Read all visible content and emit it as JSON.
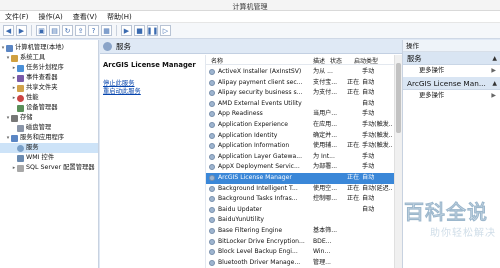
{
  "window": {
    "title": "计算机管理"
  },
  "menu": [
    "文件(F)",
    "操作(A)",
    "查看(V)",
    "帮助(H)"
  ],
  "toolbar_icons": [
    "back-icon",
    "forward-icon",
    "folder-icon",
    "view-icon",
    "refresh-icon",
    "export-icon",
    "help-icon",
    "console-icon",
    "play-icon",
    "stop-icon",
    "pause-icon",
    "restart-icon"
  ],
  "tree": {
    "root": "计算机管理(本地)",
    "system_tools": "系统工具",
    "task_scheduler": "任务计划程序",
    "event_viewer": "事件查看器",
    "shared_folders": "共享文件夹",
    "performance": "性能",
    "device_manager": "设备管理器",
    "storage": "存储",
    "disk_management": "磁盘管理",
    "services_apps": "服务和应用程序",
    "services": "服务",
    "wmi": "WMI 控件",
    "sql": "SQL Server 配置管理器"
  },
  "main": {
    "title": "服务",
    "selected_service": "ArcGIS License Manager",
    "stop_link": "停止此服务",
    "restart_link": "重启动此服务",
    "columns": {
      "name": "名称",
      "desc": "描述",
      "status": "状态",
      "startup": "启动类型"
    },
    "rows": [
      {
        "name": "ActiveX Installer (AxInstSV)",
        "desc": "为从 ...",
        "status": "",
        "startup": "手动"
      },
      {
        "name": "Alipay payment client sec...",
        "desc": "支付宝...",
        "status": "正在...",
        "startup": "自动"
      },
      {
        "name": "Alipay security business s...",
        "desc": "为支付...",
        "status": "正在...",
        "startup": "自动"
      },
      {
        "name": "AMD External Events Utility",
        "desc": "",
        "status": "",
        "startup": "自动"
      },
      {
        "name": "App Readiness",
        "desc": "当用户...",
        "status": "",
        "startup": "手动"
      },
      {
        "name": "Application Experience",
        "desc": "在应用...",
        "status": "",
        "startup": "手动(触发..."
      },
      {
        "name": "Application Identity",
        "desc": "确定并...",
        "status": "",
        "startup": "手动(触发..."
      },
      {
        "name": "Application Information",
        "desc": "使用辅...",
        "status": "正在...",
        "startup": "手动(触发..."
      },
      {
        "name": "Application Layer Gatewa...",
        "desc": "为 Int...",
        "status": "",
        "startup": "手动"
      },
      {
        "name": "AppX Deployment Servic...",
        "desc": "为部署...",
        "status": "",
        "startup": "手动"
      },
      {
        "name": "ArcGIS License Manager",
        "desc": "",
        "status": "正在...",
        "startup": "自动"
      },
      {
        "name": "Background Intelligent T...",
        "desc": "使用空...",
        "status": "正在...",
        "startup": "自动(延迟..."
      },
      {
        "name": "Background Tasks Infras...",
        "desc": "控制哪...",
        "status": "正在...",
        "startup": "自动"
      },
      {
        "name": "Baidu Updater",
        "desc": "",
        "status": "",
        "startup": "自动"
      },
      {
        "name": "BaiduYunUtility",
        "desc": "",
        "status": "",
        "startup": ""
      },
      {
        "name": "Base Filtering Engine",
        "desc": "基本筛...",
        "status": "",
        "startup": ""
      },
      {
        "name": "BitLocker Drive Encryption...",
        "desc": "BDE...",
        "status": "",
        "startup": ""
      },
      {
        "name": "Block Level Backup Engi...",
        "desc": "Win...",
        "status": "",
        "startup": ""
      },
      {
        "name": "Bluetooth Driver Manage...",
        "desc": "管理...",
        "status": "",
        "startup": ""
      }
    ]
  },
  "actions": {
    "header": "操作",
    "section1": "服务",
    "more1": "更多操作",
    "section2": "ArcGIS License Man...",
    "more2": "更多操作"
  },
  "watermark": {
    "main": "百科全说",
    "sub": "助你轻松解决"
  }
}
